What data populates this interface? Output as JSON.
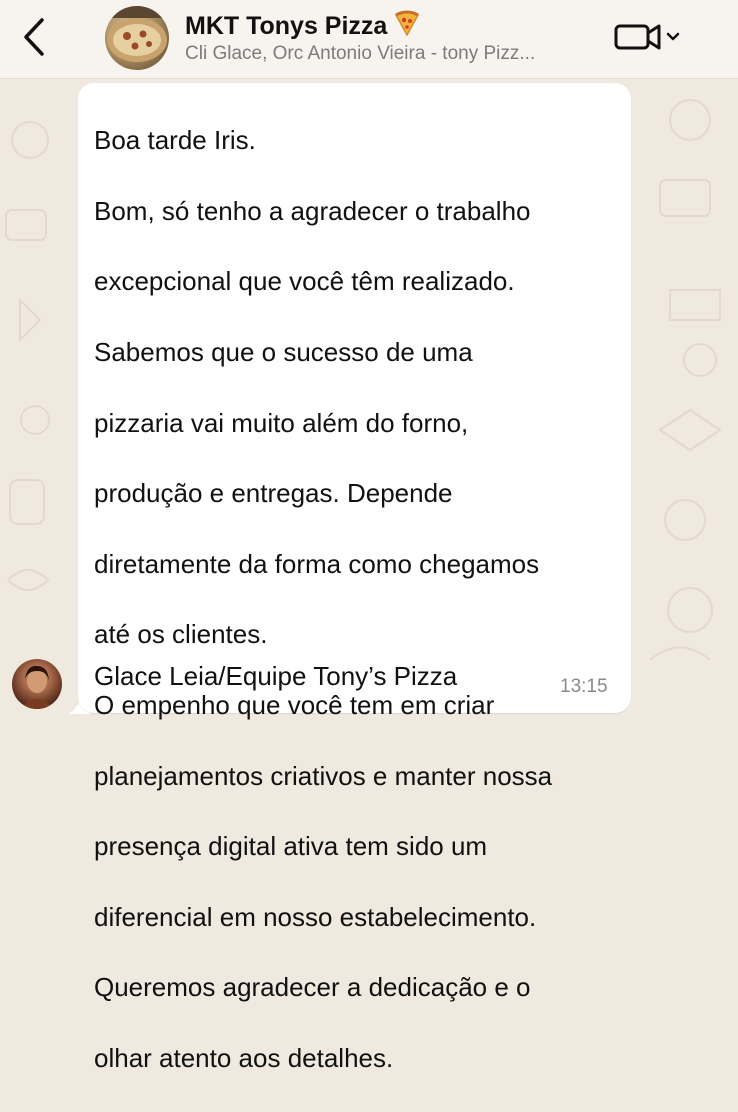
{
  "header": {
    "back_icon": "chevron-left-icon",
    "group_name": "MKT Tonys Pizza",
    "group_emoji_icon": "pizza-slice-icon",
    "participants": "Cli Glace, Orc Antonio Vieira - tony Pizz...",
    "video_icon": "video-camera-icon",
    "dropdown_icon": "chevron-down-icon"
  },
  "message": {
    "lines": [
      "Boa tarde Iris.",
      "Bom, só tenho a agradecer o trabalho",
      "excepcional que você têm realizado.",
      "Sabemos que o sucesso de uma",
      "pizzaria vai muito além do forno,",
      "produção e entregas. Depende",
      "diretamente da forma como chegamos",
      "até os clientes.",
      "O empenho que você tem em criar",
      "planejamentos criativos e manter nossa",
      "presença digital ativa tem sido um",
      "diferencial em nosso estabelecimento.",
      "Queremos agradecer a dedicação e o",
      "olhar atento aos detalhes."
    ],
    "signature": "Glace Leia/Equipe Tony’s Pizza",
    "time": "13:15"
  },
  "colors": {
    "wallpaper": "#efe9df",
    "header_bg": "#f7f4ef",
    "bubble_bg": "#ffffff",
    "text": "#111111",
    "muted": "#7b7b7b"
  }
}
